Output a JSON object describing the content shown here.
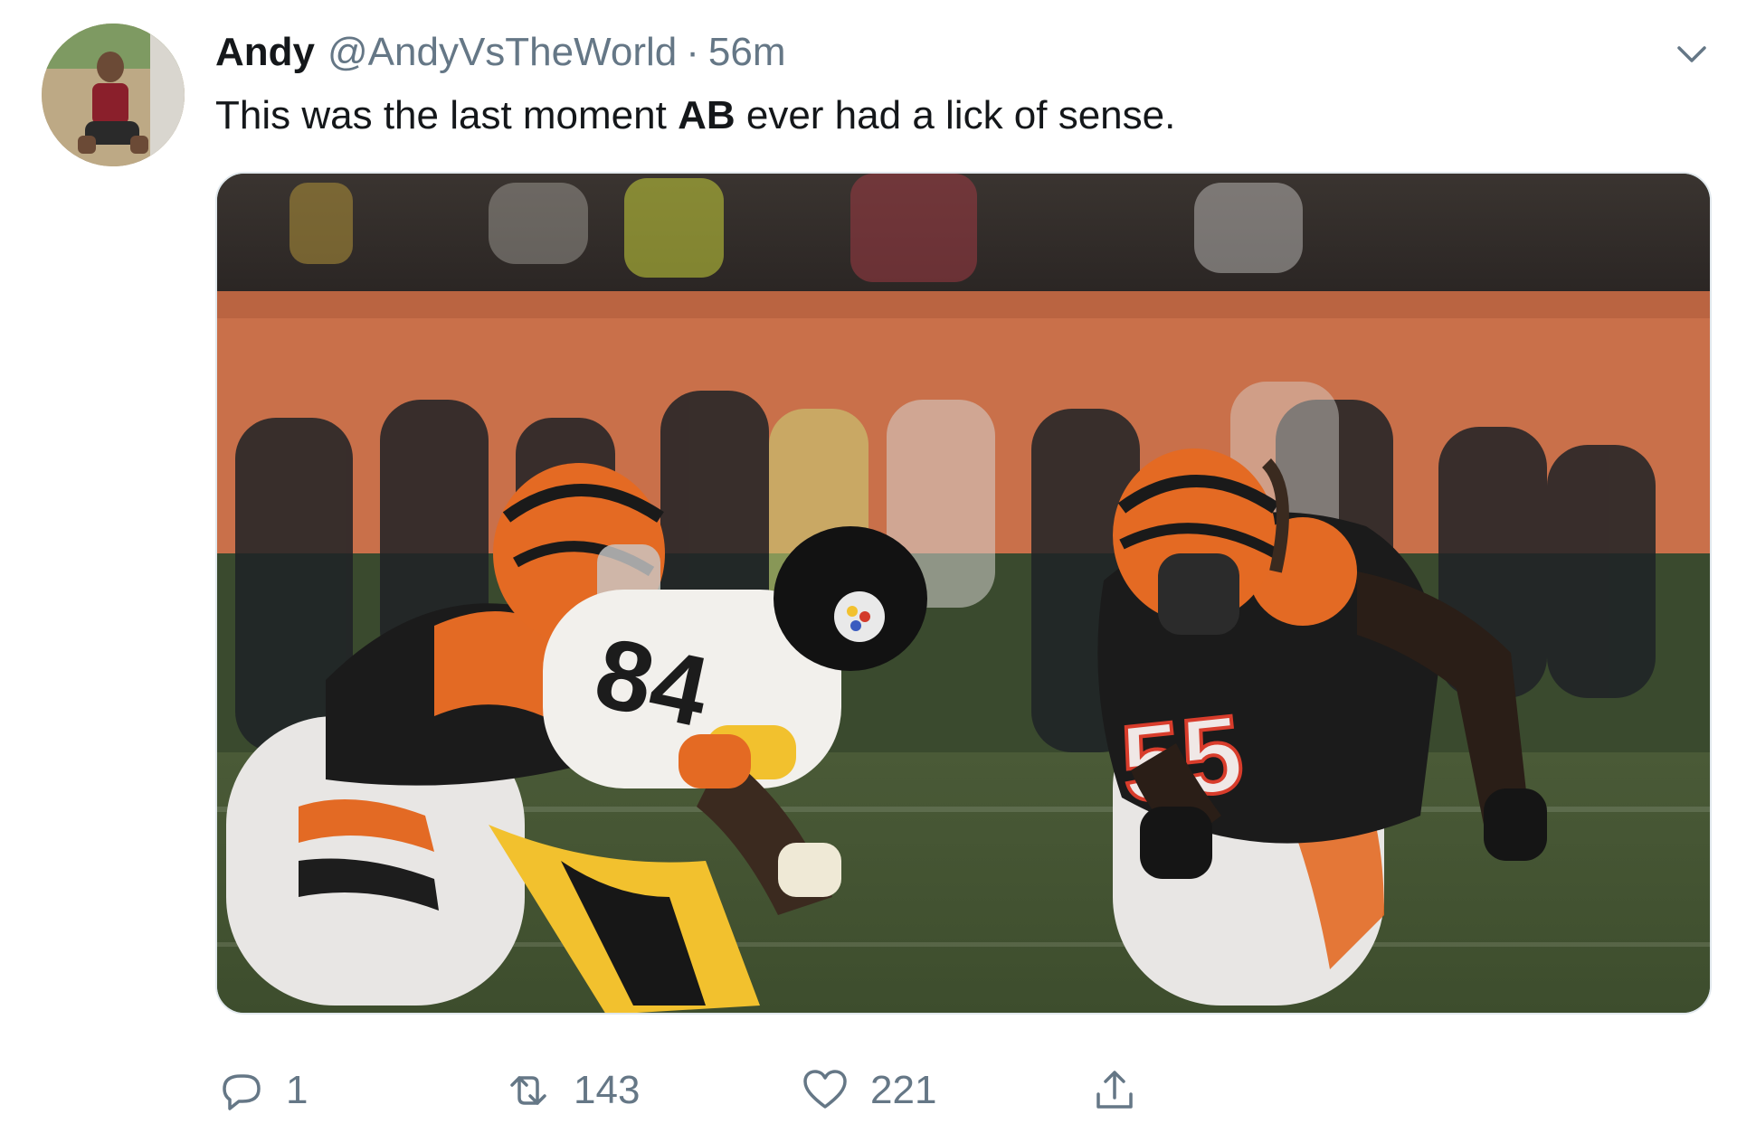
{
  "tweet": {
    "author_name": "Andy",
    "author_handle": "@AndyVsTheWorld",
    "separator": "·",
    "timestamp": "56m",
    "text_before": "This was the last moment ",
    "text_bold": "AB",
    "text_after": " ever had a lick of sense.",
    "media_alt": "",
    "jersey_numbers_visible": [
      "84",
      "55"
    ],
    "actions": {
      "reply_count": "1",
      "retweet_count": "143",
      "like_count": "221"
    }
  },
  "icons": {
    "caret": "chevron-down-icon",
    "reply": "reply-icon",
    "retweet": "retweet-icon",
    "like": "heart-icon",
    "share": "share-icon"
  },
  "colors": {
    "text_primary": "#14171a",
    "text_secondary": "#657786",
    "border": "#e1e8ed",
    "bengals_orange": "#e0652a",
    "steelers_gold": "#f2c12e"
  }
}
